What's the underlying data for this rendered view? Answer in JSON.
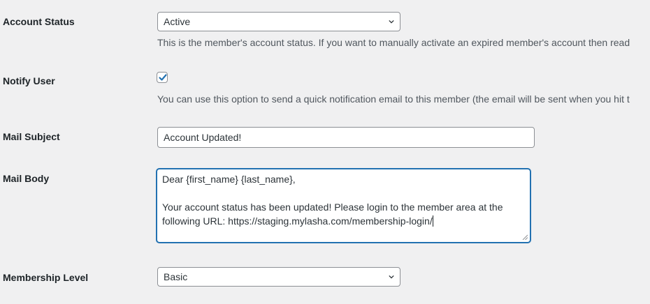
{
  "account_status": {
    "label": "Account Status",
    "selected": "Active",
    "description": "This is the member's account status. If you want to manually activate an expired member's account then read"
  },
  "notify_user": {
    "label": "Notify User",
    "checked": true,
    "description": "You can use this option to send a quick notification email to this member (the email will be sent when you hit t"
  },
  "mail_subject": {
    "label": "Mail Subject",
    "value": "Account Updated!"
  },
  "mail_body": {
    "label": "Mail Body",
    "line1": "Dear {first_name} {last_name},",
    "line2": "Your account status has been updated! Please login to the member area at the",
    "line3": "following URL: https://staging.mylasha.com/membership-login/"
  },
  "membership_level": {
    "label": "Membership Level",
    "selected": "Basic"
  },
  "colors": {
    "background": "#f0f0f1",
    "accent": "#2271b1",
    "border": "#8c8f94"
  },
  "icons": {
    "select_arrow": "chevron-down-icon",
    "checkbox_mark": "checkmark-icon",
    "textarea_resize": "resize-handle-icon"
  }
}
